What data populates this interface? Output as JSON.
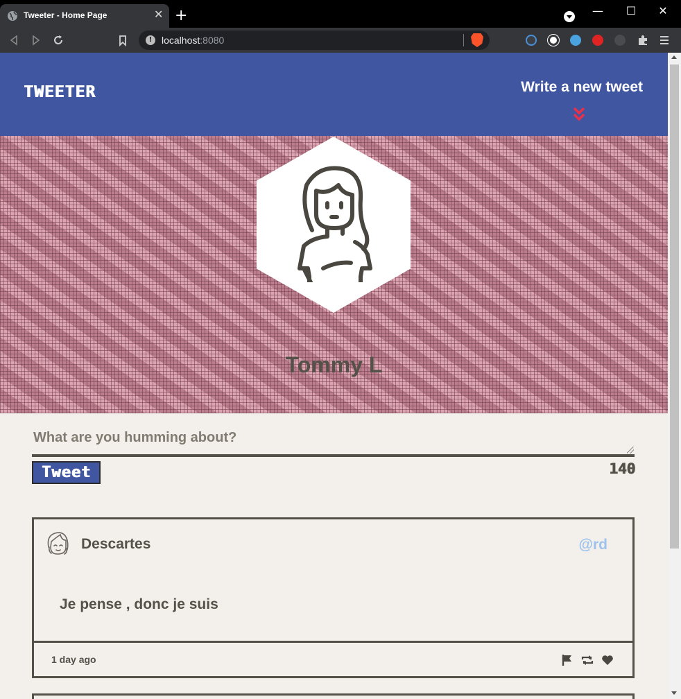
{
  "browser": {
    "tab_title": "Tweeter - Home Page",
    "url_host": "localhost",
    "url_port": ":8080"
  },
  "navbar": {
    "logo": "Tweeter",
    "write_label": "Write a new tweet"
  },
  "profile": {
    "name": "Tommy L"
  },
  "compose": {
    "placeholder": "What are you humming about?",
    "button_label": "Tweet",
    "counter": "140"
  },
  "tweets": [
    {
      "name": "Descartes",
      "handle": "@rd",
      "text": "Je pense , donc je suis",
      "time": "1 day ago"
    }
  ],
  "colors": {
    "primary": "#4056a1",
    "text": "#545149",
    "handle": "#9ec2ee",
    "accent_chevron": "#e8304a",
    "page_bg": "#f3f0ec"
  }
}
